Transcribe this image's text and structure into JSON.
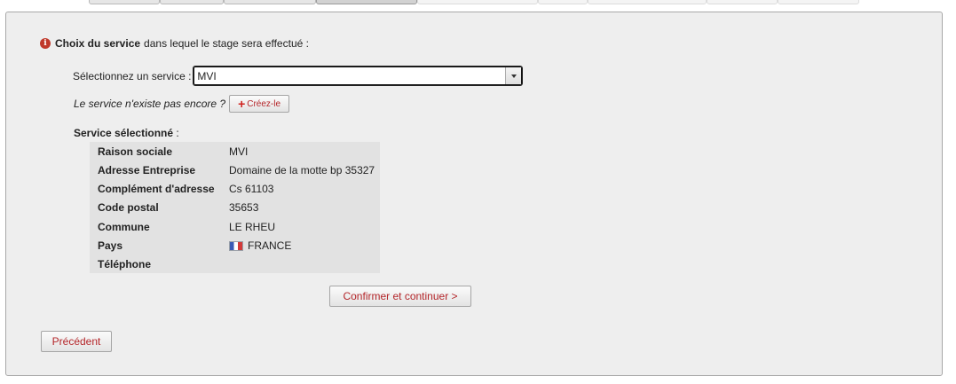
{
  "question": {
    "bold": "Choix du service",
    "rest": "dans lequel le stage sera effectué :"
  },
  "service_select": {
    "label": "Sélectionnez un service :",
    "value": "MVI"
  },
  "create": {
    "question": "Le service n'existe pas encore ?",
    "button_label": "Créez-le"
  },
  "selected": {
    "title": "Service sélectionné",
    "title_suffix": " :",
    "rows": [
      {
        "label": "Raison sociale",
        "value": "MVI"
      },
      {
        "label": "Adresse Entreprise",
        "value": "Domaine de la motte bp 35327"
      },
      {
        "label": "Complément d'adresse",
        "value": "Cs 61103"
      },
      {
        "label": "Code postal",
        "value": "35653"
      },
      {
        "label": "Commune",
        "value": "LE RHEU"
      },
      {
        "label": "Pays",
        "value": "FRANCE"
      },
      {
        "label": "Téléphone",
        "value": ""
      }
    ]
  },
  "actions": {
    "confirm_label": "Confirmer et continuer >",
    "previous_label": "Précédent"
  },
  "colors": {
    "accent": "#b4262a",
    "icon": "#c0392b",
    "panel_bg": "#eeeeee"
  },
  "icons": {
    "info": "info-circle-icon",
    "add": "plus-icon",
    "dropdown": "chevron-down-icon",
    "flag": "flag-france-icon"
  }
}
